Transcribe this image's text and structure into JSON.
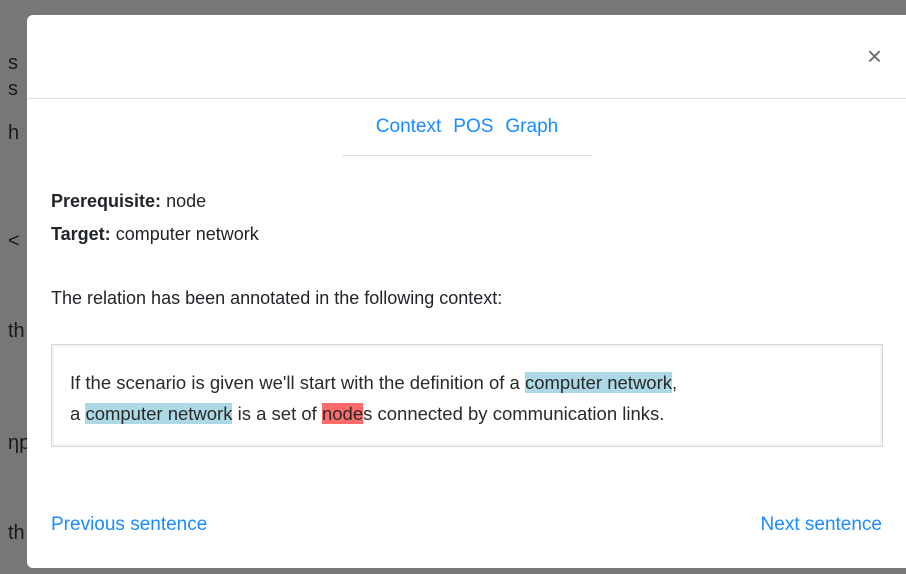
{
  "backdrop": {
    "fragments": [
      "s",
      "s",
      "h",
      "<",
      "th",
      "ηp",
      "th"
    ]
  },
  "modal": {
    "close_label": "×",
    "tabs": [
      {
        "label": "Context"
      },
      {
        "label": "POS"
      },
      {
        "label": "Graph"
      }
    ],
    "prerequisite_label": "Prerequisite:",
    "prerequisite_value": "node",
    "target_label": "Target:",
    "target_value": "computer network",
    "intro_text": "The relation has been annotated in the following context:",
    "context": {
      "line1_a": "If the scenario is given we'll start with the definition of a ",
      "line1_target": "computer network",
      "line1_b": ",",
      "line2_a": "a ",
      "line2_target": "computer network",
      "line2_b": " is a set of ",
      "line2_prereq": "node",
      "line2_c": "s connected by communication links."
    },
    "prev_label": "Previous sentence",
    "next_label": "Next sentence"
  },
  "colors": {
    "target_highlight": "#add8e6",
    "prerequisite_highlight": "#ff6b6b",
    "link": "#1a8cff"
  }
}
